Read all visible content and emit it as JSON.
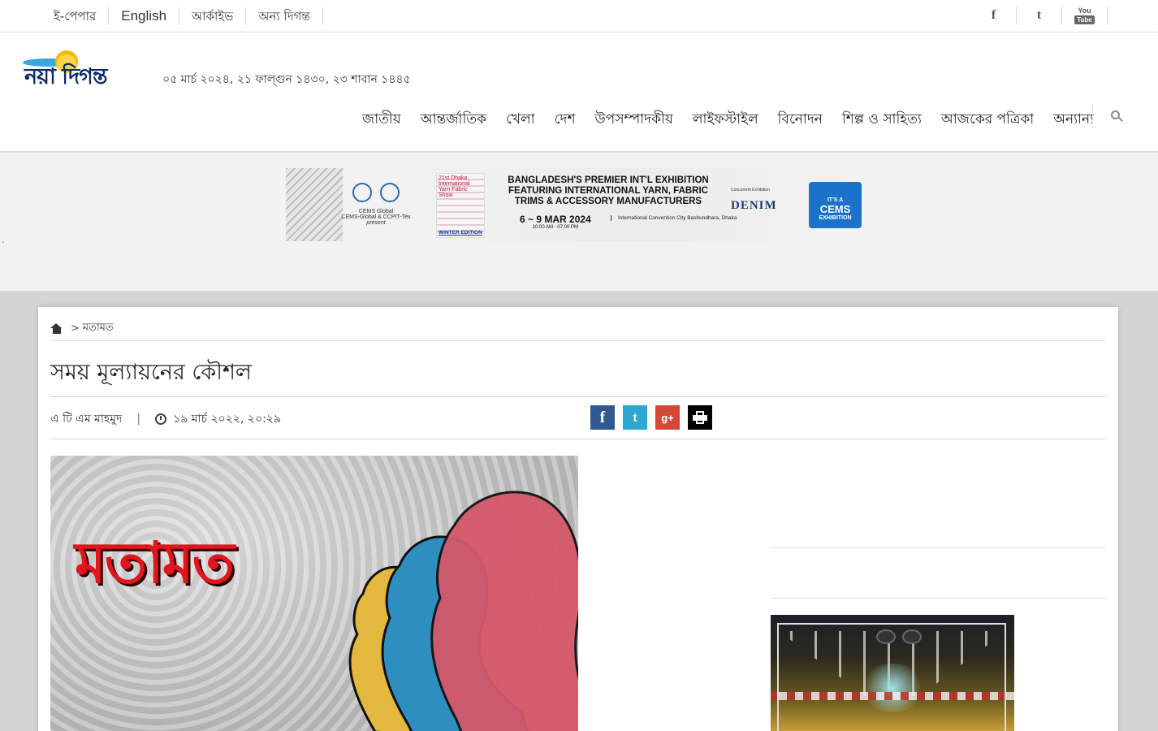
{
  "topbar": {
    "links": [
      "ই-পেপার",
      "English",
      "আর্কাইভ",
      "অন্য দিগন্ত"
    ],
    "social": [
      {
        "icon": "facebook-icon",
        "glyph": "f"
      },
      {
        "icon": "twitter-icon",
        "glyph": "t"
      },
      {
        "icon": "youtube-icon",
        "glyph": "You",
        "sub": "Tube"
      }
    ]
  },
  "header": {
    "logo_text": "নয়া দিগন্ত",
    "date": "০৫ মার্চ ২০২৪, ২১ ফাল্গুন ১৪৩০, ২৩ শাবান ১৪৪৫",
    "nav": [
      "জাতীয়",
      "আন্তর্জাতিক",
      "খেলা",
      "দেশ",
      "উপসম্পাদকীয়",
      "লাইফস্টাইল",
      "বিনোদন",
      "শিল্প ও সাহিত্য",
      "আজকের পত্রিকা",
      "অন্যান্য"
    ],
    "search_icon": "search-icon"
  },
  "ad": {
    "presenter": "CEMS-Global & CCPIT-Tex",
    "presenter_sub": "present",
    "cems_mark": "CEMS Global",
    "show_name": "21st Dhaka International Yarn Fabric Show",
    "edition": "WINTER EDITION",
    "headline": "BANGLADESH'S PREMIER INT'L EXHIBITION FEATURING INTERNATIONAL YARN, FABRIC TRIMS & ACCESSORY MANUFACTURERS",
    "dates": "6 ~ 9 MAR 2024",
    "hours": "10:00 AM - 07:00 PM",
    "venue": "International Convention City Bashundhara, Dhaka",
    "concurrent": "Concurrent Exhibition",
    "denim": "DENIM",
    "badge_top": "IT'S A",
    "badge_mid": "CEMS",
    "badge_bottom": "EXHIBITION"
  },
  "stray_mark": "`",
  "article": {
    "breadcrumb": {
      "home_icon": "home-icon",
      "separator": ">",
      "section": "মতামত"
    },
    "title": "সময় মূল্যায়নের কৌশল",
    "author": "এ টি এম মাহমুদ",
    "divider": "|",
    "clock_icon": "clock-icon",
    "published": "১৯ মার্চ ২০২২, ২০:২৯",
    "share": [
      {
        "name": "facebook-share-button",
        "glyph": "f",
        "color": "#305891"
      },
      {
        "name": "twitter-share-button",
        "glyph": "t",
        "color": "#2ca8d2"
      },
      {
        "name": "google-plus-share-button",
        "glyph": "g+",
        "color": "#d34836"
      },
      {
        "name": "print-button",
        "glyph": "",
        "color": "#000000"
      }
    ],
    "feature_word": "মতামত"
  },
  "colors": {
    "accent_red": "#e3141c",
    "nav_text": "#222222",
    "page_bg": "#d4d4d2"
  }
}
